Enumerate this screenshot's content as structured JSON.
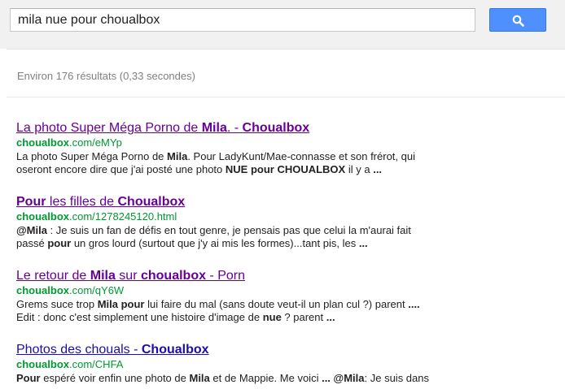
{
  "search": {
    "query": "mila nue pour choualbox"
  },
  "stats": {
    "text": "Environ 176 résultats (0,33 secondes)"
  },
  "results": [
    {
      "title": [
        {
          "t": "La photo Super Méga Porno de ",
          "b": false
        },
        {
          "t": "Mila",
          "b": true
        },
        {
          "t": ". - ",
          "b": false
        },
        {
          "t": "Choualbox",
          "b": true
        }
      ],
      "url": [
        {
          "t": "choualbox",
          "b": true
        },
        {
          "t": ".com/eMYp",
          "b": false
        }
      ],
      "snippet": [
        {
          "t": "La photo Super Méga Porno de ",
          "b": false
        },
        {
          "t": "Mila",
          "b": true
        },
        {
          "t": ". Pour LadyKunt/Mae-connasse et son frérot, qui oseront encore dire que j'ai posté une photo ",
          "b": false
        },
        {
          "t": "NUE pour CHOUALBOX",
          "b": true
        },
        {
          "t": " il y a ",
          "b": false
        },
        {
          "t": "...",
          "b": true
        }
      ]
    },
    {
      "title": [
        {
          "t": "Pour",
          "b": true
        },
        {
          "t": " les filles de ",
          "b": false
        },
        {
          "t": "Choualbox",
          "b": true
        }
      ],
      "url": [
        {
          "t": "choualbox",
          "b": true
        },
        {
          "t": ".com/1278245120.html",
          "b": false
        }
      ],
      "snippet": [
        {
          "t": "@Mila",
          "b": true
        },
        {
          "t": " : Je suis un fan de défis en tout genre, je pensais pas que celui la m'aurai fait passé ",
          "b": false
        },
        {
          "t": "pour",
          "b": true
        },
        {
          "t": " un gros lourd (surtout que j'y ai mis les formes)...tant pis, les ",
          "b": false
        },
        {
          "t": "...",
          "b": true
        }
      ]
    },
    {
      "title": [
        {
          "t": "Le retour de ",
          "b": false
        },
        {
          "t": "Mila",
          "b": true
        },
        {
          "t": " sur ",
          "b": false
        },
        {
          "t": "choualbox",
          "b": true
        },
        {
          "t": " - Porn",
          "b": false
        }
      ],
      "url": [
        {
          "t": "choualbox",
          "b": true
        },
        {
          "t": ".com/qY6W",
          "b": false
        }
      ],
      "snippet": [
        {
          "t": "Grems suce trop ",
          "b": false
        },
        {
          "t": "Mila pour",
          "b": true
        },
        {
          "t": " lui faire du mal (sans doute veut-il un plan cul ?) parent ",
          "b": false
        },
        {
          "t": "....",
          "b": true
        },
        {
          "t": " Edit : donc c'est simplement une histoire d'image de ",
          "b": false
        },
        {
          "t": "nue",
          "b": true
        },
        {
          "t": " ? parent ",
          "b": false
        },
        {
          "t": "...",
          "b": true
        }
      ]
    },
    {
      "title": [
        {
          "t": "Photos des chouals - ",
          "b": false
        },
        {
          "t": "Choualbox",
          "b": true
        }
      ],
      "url": [
        {
          "t": "choualbox",
          "b": true
        },
        {
          "t": ".com/CHFA",
          "b": false
        }
      ],
      "snippet": [
        {
          "t": "Pour",
          "b": true
        },
        {
          "t": " espéré voir enfin une photo de ",
          "b": false
        },
        {
          "t": "Mila",
          "b": true
        },
        {
          "t": " et de Mappie. Me voici ",
          "b": false
        },
        {
          "t": "...",
          "b": true
        },
        {
          "t": " ",
          "b": false
        },
        {
          "t": "@Mila",
          "b": true
        },
        {
          "t": ": Je suis dans",
          "b": false
        }
      ]
    }
  ],
  "colors": {
    "visited_link": "#660099",
    "link": "#1a0dab",
    "url": "#009933",
    "button": "#4d90fe"
  }
}
